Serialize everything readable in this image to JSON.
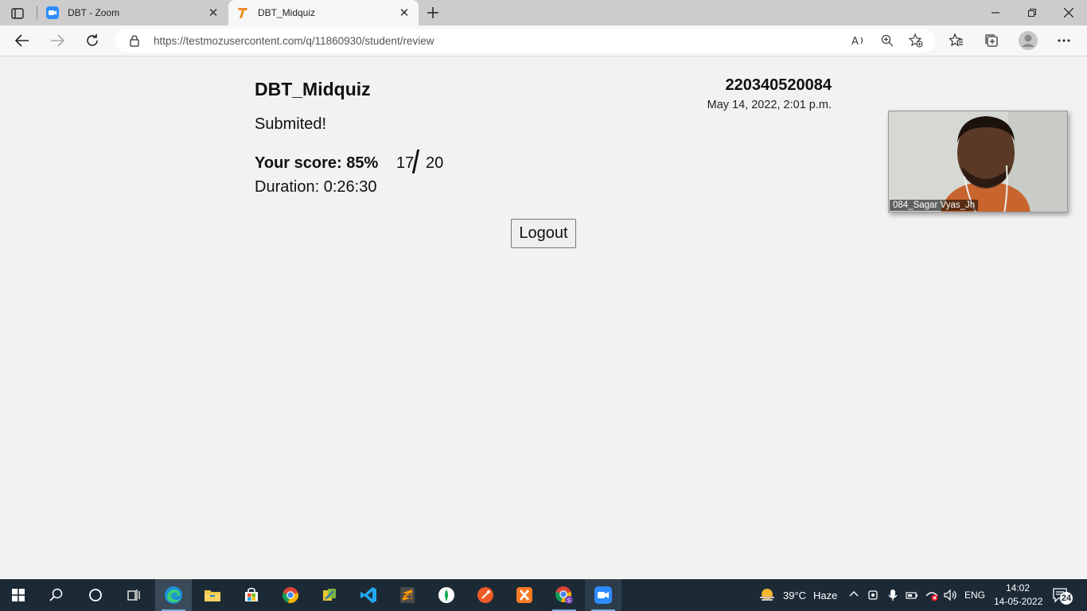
{
  "browser": {
    "tabs": [
      {
        "label": "DBT - Zoom",
        "active": false,
        "icon": "zoom-icon"
      },
      {
        "label": "DBT_Midquiz",
        "active": true,
        "icon": "testmoz-icon"
      }
    ],
    "url": "https://testmozusercontent.com/q/11860930/student/review"
  },
  "page": {
    "quiz_title": "DBT_Midquiz",
    "student_id": "220340520084",
    "timestamp": "May 14, 2022, 2:01 p.m.",
    "status": "Submited!",
    "score_label": "Your score: 85%",
    "score_correct": "17",
    "score_total": "20",
    "duration": "Duration: 0:26:30",
    "logout_label": "Logout"
  },
  "video_overlay": {
    "participant_name": "084_Sagar Vyas_Jh"
  },
  "taskbar": {
    "apps": [
      "start-icon",
      "search-icon",
      "cortana-icon",
      "task-view-icon",
      "edge-icon",
      "file-explorer-icon",
      "store-icon",
      "chrome-icon",
      "sticky-app-icon",
      "vscode-icon",
      "sublime-icon",
      "mongodb-compass-icon",
      "postman-icon",
      "xampp-icon",
      "chrome-profile-icon",
      "zoom-icon"
    ],
    "weather_temp": "39°C",
    "weather_desc": "Haze",
    "language": "ENG",
    "time": "14:02",
    "date": "14-05-2022",
    "notification_count": "24"
  },
  "colors": {
    "taskbar_bg": "#1c2a36",
    "page_bg": "#f2f2f2",
    "tabstrip_bg": "#cccccc"
  }
}
